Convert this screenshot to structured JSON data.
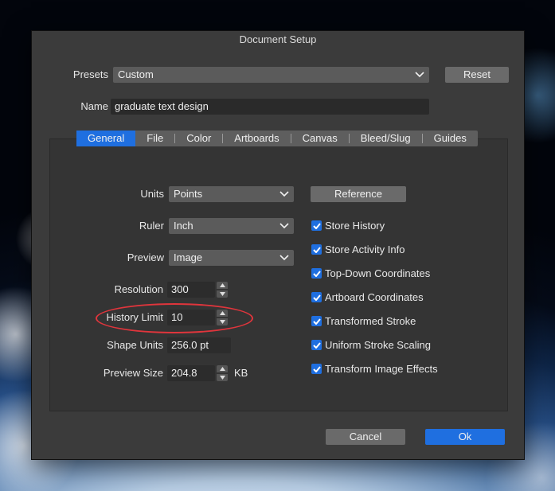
{
  "window": {
    "title": "Document Setup"
  },
  "presets": {
    "label": "Presets",
    "value": "Custom",
    "reset_label": "Reset"
  },
  "name_field": {
    "label": "Name",
    "value": "graduate text design"
  },
  "tabs": [
    "General",
    "File",
    "Color",
    "Artboards",
    "Canvas",
    "Bleed/Slug",
    "Guides"
  ],
  "active_tab": "General",
  "general": {
    "units": {
      "label": "Units",
      "value": "Points"
    },
    "ruler": {
      "label": "Ruler",
      "value": "Inch"
    },
    "preview": {
      "label": "Preview",
      "value": "Image"
    },
    "resolution": {
      "label": "Resolution",
      "value": "300"
    },
    "history_limit": {
      "label": "History Limit",
      "value": "10"
    },
    "shape_units": {
      "label": "Shape Units",
      "value": "256.0 pt"
    },
    "preview_size": {
      "label": "Preview Size",
      "value": "204.8",
      "unit": "KB"
    },
    "reference_label": "Reference",
    "checkboxes": [
      {
        "label": "Store History",
        "checked": true
      },
      {
        "label": "Store Activity Info",
        "checked": true
      },
      {
        "label": "Top-Down Coordinates",
        "checked": true
      },
      {
        "label": "Artboard Coordinates",
        "checked": true
      },
      {
        "label": "Transformed Stroke",
        "checked": true
      },
      {
        "label": "Uniform Stroke Scaling",
        "checked": true
      },
      {
        "label": "Transform Image Effects",
        "checked": true
      }
    ]
  },
  "footer": {
    "cancel_label": "Cancel",
    "ok_label": "Ok"
  },
  "colors": {
    "accent": "#1f6fe0",
    "highlight_ellipse": "#e0353c"
  }
}
